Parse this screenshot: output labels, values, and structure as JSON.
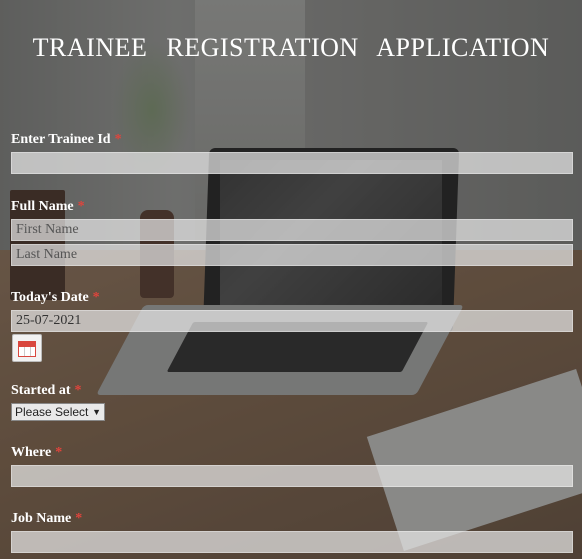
{
  "title": "TRAINEE  REGISTRATION  APPLICATION",
  "required_marker": "*",
  "fields": {
    "trainee_id": {
      "label": "Enter Trainee Id",
      "value": ""
    },
    "full_name": {
      "label": "Full Name",
      "first_placeholder": "First Name",
      "last_placeholder": "Last Name"
    },
    "todays_date": {
      "label": "Today's Date",
      "value": "25-07-2021"
    },
    "started_at": {
      "label": "Started at",
      "selected": "Please Select"
    },
    "where": {
      "label": "Where",
      "value": ""
    },
    "job_name": {
      "label": "Job Name",
      "value": ""
    }
  },
  "icons": {
    "calendar": "calendar-icon",
    "dropdown": "chevron-down-icon"
  },
  "colors": {
    "required": "#e0443c",
    "text": "#ffffff"
  }
}
